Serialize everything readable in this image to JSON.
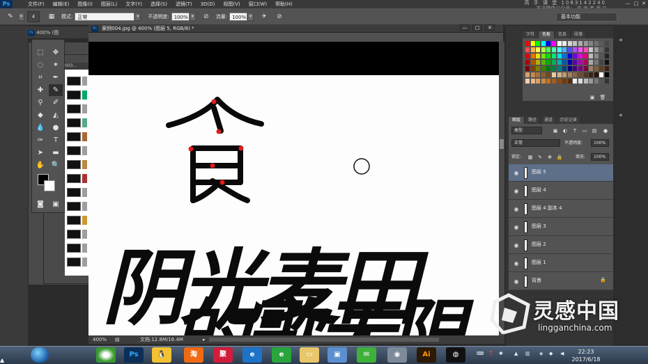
{
  "menubar": {
    "app_logo": "Ps",
    "items": [
      "文件(F)",
      "编辑(E)",
      "图像(I)",
      "图层(L)",
      "文字(Y)",
      "选择(S)",
      "滤镜(T)",
      "3D(D)",
      "视图(V)",
      "窗口(W)",
      "帮助(H)"
    ],
    "watermark_top": "高 手 课 堂  1083142240",
    "watermark_bottom": "关注微信公众号：  咨 询 老 师 Q"
  },
  "options": {
    "brush_size": "4",
    "mode_label": "模式:",
    "mode_value": "正常",
    "opacity_label": "不透明度:",
    "opacity_value": "100%",
    "flow_label": "流量:",
    "flow_value": "100%",
    "workspace": "基本功能"
  },
  "document": {
    "tab_title": "案例004.jpg @ 400% (图层 5, RGB/8) *",
    "bg_tab_label": "400% (图",
    "bg_tab_label2": "003...",
    "zoom": "400%",
    "doc_info": "文档:12.8M/16.4M",
    "canvas_top_char": "食",
    "canvas_text_line1": "阴光麦田",
    "canvas_text_line2": "的歌无限"
  },
  "swatches": {
    "tabs": [
      "字符",
      "色板",
      "信息",
      "段落"
    ],
    "active": "色板"
  },
  "layers": {
    "tabs": [
      "图层",
      "路径",
      "通道",
      "历史记录"
    ],
    "active": "图层",
    "filter_label": "类型",
    "blend_mode": "正常",
    "opacity_label": "不透明度:",
    "opacity_value": "100%",
    "lock_label": "锁定:",
    "fill_label": "填充:",
    "fill_value": "100%",
    "items": [
      {
        "name": "图层 5",
        "selected": true
      },
      {
        "name": "图层 4",
        "selected": false
      },
      {
        "name": "图层 4 副本 4",
        "selected": false
      },
      {
        "name": "图层 3",
        "selected": false
      },
      {
        "name": "图层 2",
        "selected": false
      },
      {
        "name": "图层 1",
        "selected": false
      },
      {
        "name": "背景",
        "selected": false,
        "locked": true
      }
    ]
  },
  "watermark": {
    "brand": "灵感中国",
    "url": "lingganchina.com"
  },
  "taskbar": {
    "apps": [
      "Ps",
      "淘",
      "聚",
      "Ai"
    ],
    "clock_time": "22:23",
    "clock_date": "2017/6/18"
  },
  "colors": {
    "panel": "#535353",
    "selected_layer": "#5d6f89",
    "ps_blue": "#31a8ff"
  }
}
